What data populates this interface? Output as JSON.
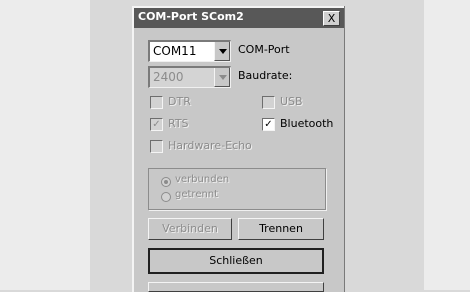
{
  "window": {
    "title": "COM-Port SCom2",
    "close_label": "X"
  },
  "port": {
    "value": "COM11",
    "label": "COM-Port"
  },
  "baud": {
    "value": "2400",
    "label": "Baudrate:"
  },
  "checks": {
    "dtr": {
      "label": "DTR",
      "checked": false,
      "enabled": false
    },
    "usb": {
      "label": "USB",
      "checked": false,
      "enabled": false
    },
    "rts": {
      "label": "RTS",
      "checked": true,
      "enabled": false
    },
    "bluetooth": {
      "label": "Bluetooth",
      "checked": true,
      "enabled": true
    },
    "echo": {
      "label": "Hardware-Echo",
      "checked": false,
      "enabled": false
    }
  },
  "status": {
    "connected_label": "verbunden",
    "disconnected_label": "getrennt"
  },
  "buttons": {
    "connect": "Verbinden",
    "disconnect": "Trennen",
    "close": "Schließen"
  },
  "colors": {
    "titlebar": "#585858",
    "face": "#c8c8c8"
  }
}
